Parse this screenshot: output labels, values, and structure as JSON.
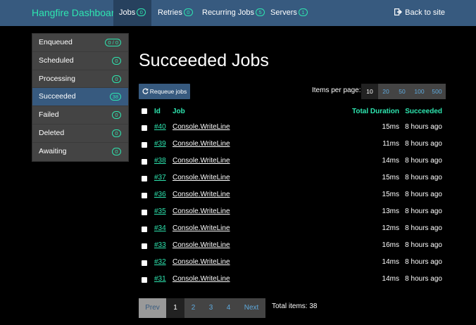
{
  "navbar": {
    "brand": "Hangfire Dashboard",
    "items": [
      {
        "label": "Jobs",
        "count": "0"
      },
      {
        "label": "Retries",
        "count": "0"
      },
      {
        "label": "Recurring Jobs",
        "count": "5"
      },
      {
        "label": "Servers",
        "count": "1"
      }
    ],
    "back_link": "Back to site"
  },
  "sidebar": {
    "items": [
      {
        "label": "Enqueued",
        "count": "0 / 0"
      },
      {
        "label": "Scheduled",
        "count": "0"
      },
      {
        "label": "Processing",
        "count": "0"
      },
      {
        "label": "Succeeded",
        "count": "38"
      },
      {
        "label": "Failed",
        "count": "0"
      },
      {
        "label": "Deleted",
        "count": "0"
      },
      {
        "label": "Awaiting",
        "count": "0"
      }
    ]
  },
  "main": {
    "title": "Succeeded Jobs",
    "requeue_label": "Requeue jobs",
    "items_per_page_label": "Items per page:",
    "items_per_page_options": [
      "10",
      "20",
      "50",
      "100",
      "500"
    ],
    "selected_items_per_page": "10"
  },
  "table": {
    "headers": {
      "id": "Id",
      "job": "Job",
      "duration": "Total Duration",
      "succeeded": "Succeeded"
    },
    "rows": [
      {
        "id": "#40",
        "job": "Console.WriteLine",
        "duration": "15ms",
        "succeeded": "8 hours ago"
      },
      {
        "id": "#39",
        "job": "Console.WriteLine",
        "duration": "11ms",
        "succeeded": "8 hours ago"
      },
      {
        "id": "#38",
        "job": "Console.WriteLine",
        "duration": "14ms",
        "succeeded": "8 hours ago"
      },
      {
        "id": "#37",
        "job": "Console.WriteLine",
        "duration": "15ms",
        "succeeded": "8 hours ago"
      },
      {
        "id": "#36",
        "job": "Console.WriteLine",
        "duration": "15ms",
        "succeeded": "8 hours ago"
      },
      {
        "id": "#35",
        "job": "Console.WriteLine",
        "duration": "13ms",
        "succeeded": "8 hours ago"
      },
      {
        "id": "#34",
        "job": "Console.WriteLine",
        "duration": "12ms",
        "succeeded": "8 hours ago"
      },
      {
        "id": "#33",
        "job": "Console.WriteLine",
        "duration": "16ms",
        "succeeded": "8 hours ago"
      },
      {
        "id": "#32",
        "job": "Console.WriteLine",
        "duration": "14ms",
        "succeeded": "8 hours ago"
      },
      {
        "id": "#31",
        "job": "Console.WriteLine",
        "duration": "14ms",
        "succeeded": "8 hours ago"
      }
    ]
  },
  "pagination": {
    "prev": "Prev",
    "pages": [
      "1",
      "2",
      "3",
      "4"
    ],
    "current": "1",
    "next": "Next",
    "total_items": "Total items: 38"
  },
  "colors": {
    "navbar": "#375a7f",
    "accent": "#2ee6b0",
    "link": "#5ea9dd",
    "background": "#000000",
    "sidebar": "#444444"
  },
  "icons": {
    "refresh": "refresh-icon",
    "back": "sign-out-icon"
  }
}
